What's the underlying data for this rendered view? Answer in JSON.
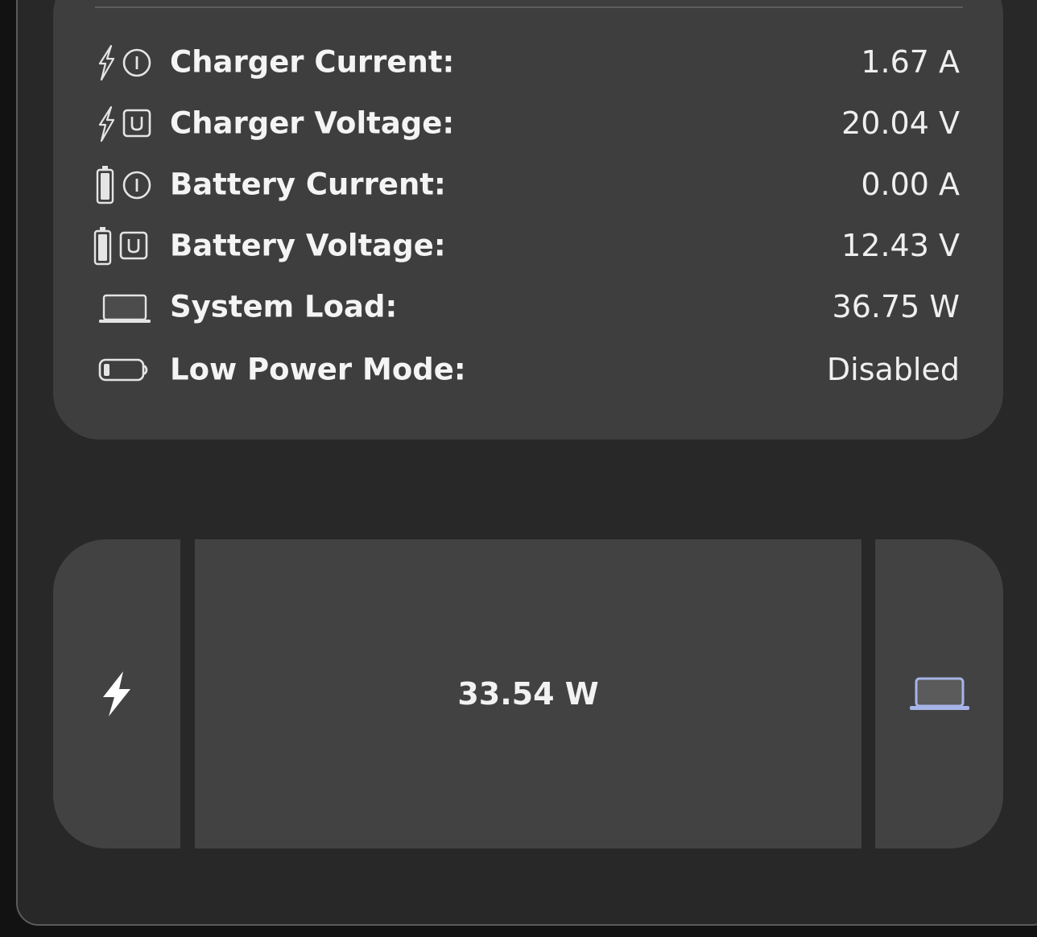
{
  "stats": [
    {
      "label": "Charger Current:",
      "value": "1.67 A",
      "icons": [
        "lightning-icon",
        "current-icon"
      ]
    },
    {
      "label": "Charger Voltage:",
      "value": "20.04 V",
      "icons": [
        "lightning-icon",
        "voltage-icon"
      ]
    },
    {
      "label": "Battery Current:",
      "value": "0.00 A",
      "icons": [
        "battery-icon",
        "current-icon"
      ]
    },
    {
      "label": "Battery Voltage:",
      "value": "12.43 V",
      "icons": [
        "battery-icon",
        "voltage-icon"
      ]
    },
    {
      "label": "System Load:",
      "value": "36.75 W",
      "icons": [
        "laptop-icon"
      ]
    },
    {
      "label": "Low Power Mode:",
      "value": "Disabled",
      "icons": [
        "low-battery-icon"
      ]
    }
  ],
  "flow": {
    "value": "33.54 W",
    "source_icon": "lightning-bolt-icon",
    "sink_icon": "laptop-icon",
    "sink_icon_color": "#a7b4e8"
  }
}
